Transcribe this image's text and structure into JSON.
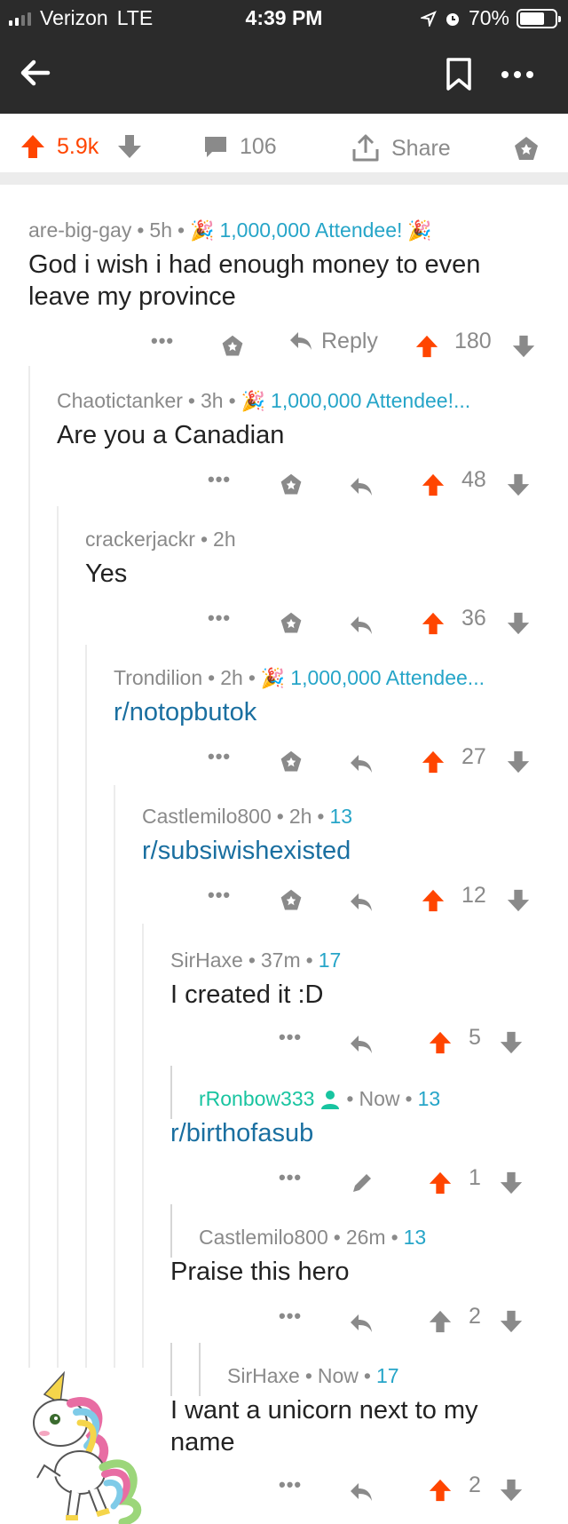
{
  "status_bar": {
    "carrier": "Verizon",
    "network": "LTE",
    "time": "4:39 PM",
    "battery": "70%",
    "battery_level": 0.7
  },
  "post_actions": {
    "upvotes": "5.9k",
    "comments": "106",
    "share_label": "Share"
  },
  "comments": [
    {
      "author": "are-big-gay",
      "age": "5h",
      "flair": "1,000,000 Attendee!",
      "text": "God i wish i had enough money to even leave my province",
      "reply_label": "Reply",
      "score": "180"
    },
    {
      "author": "Chaotictanker",
      "age": "3h",
      "flair": "1,000,000 Attendee!...",
      "text": "Are you a Canadian",
      "score": "48"
    },
    {
      "author": "crackerjackr",
      "age": "2h",
      "text": "Yes",
      "score": "36"
    },
    {
      "author": "Trondilion",
      "age": "2h",
      "flair": "1,000,000 Attendee...",
      "text": "r/notopbutok",
      "score": "27"
    },
    {
      "author": "Castlemilo800",
      "age": "2h",
      "flair": "13",
      "text": "r/subsiwishexisted",
      "score": "12"
    },
    {
      "author": "SirHaxe",
      "age": "37m",
      "flair": "17",
      "text": "I created it :D",
      "score": "5"
    },
    {
      "author": "rRonbow333",
      "age": "Now",
      "flair": "13",
      "text": "r/birthofasub",
      "score": "1"
    },
    {
      "author": "Castlemilo800",
      "age": "26m",
      "flair": "13",
      "text": "Praise this hero",
      "score": "2"
    },
    {
      "author": "SirHaxe",
      "age": "Now",
      "flair": "17",
      "text": "I want a unicorn next to my name",
      "score": "2"
    }
  ],
  "colors": {
    "upvote": "#ff4500",
    "flair": "#26a5c8",
    "link": "#1a6fa0",
    "mod": "#18c4a0",
    "dark_bar": "#2b2b2b"
  },
  "icons": [
    "back-arrow-icon",
    "bookmark-icon",
    "more-icon",
    "upvote-icon",
    "downvote-icon",
    "comment-icon",
    "share-icon",
    "award-icon",
    "reply-icon",
    "edit-icon",
    "moderator-icon",
    "party-popper-icon",
    "unicorn-sticker"
  ]
}
